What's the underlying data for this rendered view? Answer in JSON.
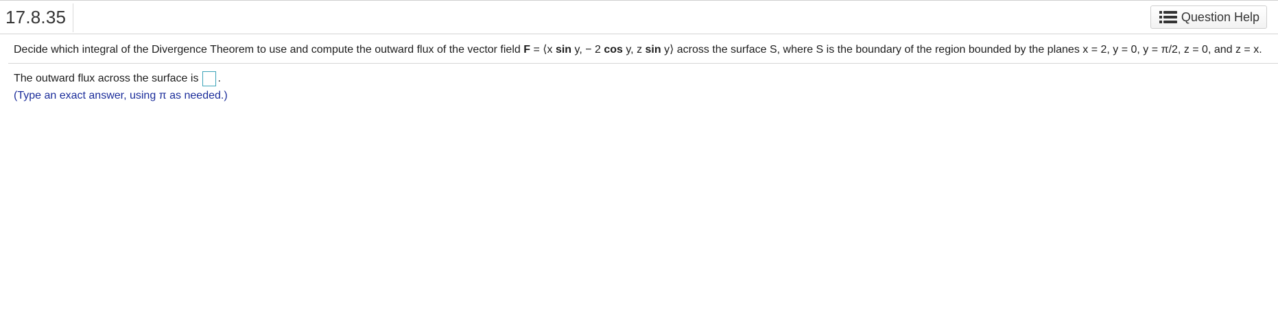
{
  "header": {
    "question_number": "17.8.35",
    "help_button_label": "Question Help",
    "help_icon": "list-icon"
  },
  "question": {
    "text_before_field": "Decide which integral of the Divergence Theorem to use and compute the outward flux of the vector field ",
    "field_symbol": "F",
    "equals": " = ",
    "vector": {
      "open": "⟨x ",
      "c1_func": "sin",
      "c1_rest": " y, − 2 ",
      "c2_func": "cos",
      "c2_rest": " y, z ",
      "c3_func": "sin",
      "c3_rest": " y⟩"
    },
    "text_after_field": " across the surface S, where S is the boundary of the region bounded by the planes x = 2, y = 0, y = π/2, z = 0, and z = x."
  },
  "answer": {
    "prompt": "The outward flux across the surface is",
    "value": "",
    "trailing": ".",
    "hint": "(Type an exact answer, using π as needed.)"
  },
  "colors": {
    "hint_text": "#1a2c9a",
    "answer_box_border": "#3aa2b7",
    "divider": "#d6d6d6"
  }
}
